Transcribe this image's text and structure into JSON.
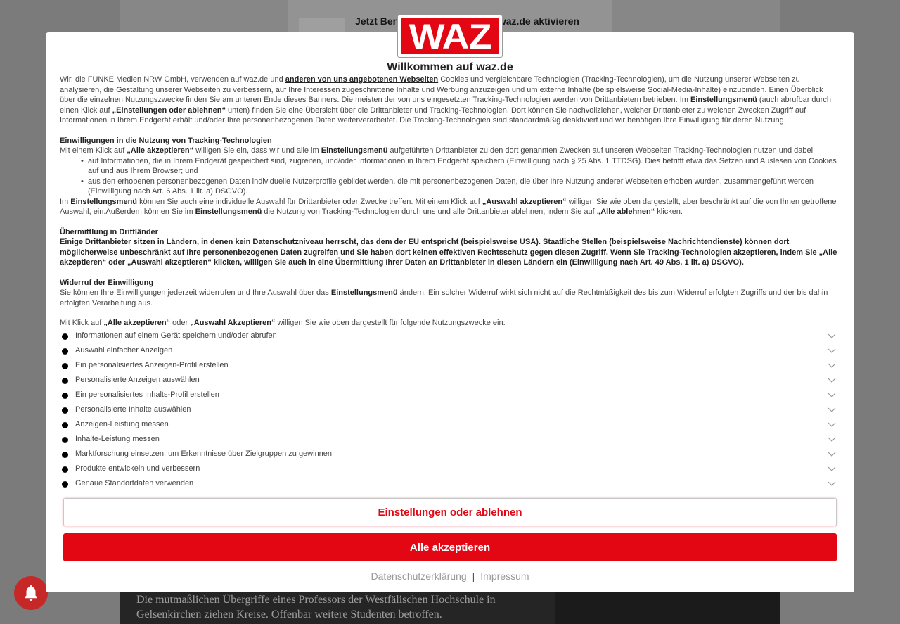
{
  "background": {
    "notify_text": "Jetzt Benachrichtigungen von waz.de aktivieren",
    "teaser_text": "Die mutmaßlichen Übergriffe eines Professors der Westfälischen Hochschule in Gelsenkirchen ziehen Kreise. Offenbar weitere Studenten betroffen."
  },
  "bell_icon": "bell-icon",
  "modal": {
    "logo_text": "WAZ",
    "title": "Willkommen auf waz.de",
    "intro": {
      "t1": "Wir, die FUNKE Medien NRW GmbH, verwenden auf waz.de und ",
      "link1": "anderen von uns angebotenen Webseiten",
      "t2": " Cookies und vergleichbare Technologien (Tracking-Technologien), um die Nutzung unserer Webseiten zu analysieren, die Gestaltung unserer Webseiten zu verbessern, auf Ihre Interessen zugeschnittene Inhalte und Werbung anzuzeigen und um externe Inhalte (beispielsweise Social-Media-Inhalte) einzubinden. Einen Überblick über die einzelnen Nutzungszwecke finden Sie am unteren Ende dieses Banners. Die meisten der von uns eingesetzten Tracking-Technologien werden von Drittanbietern betrieben. Im ",
      "b1": "Einstellungsmenü",
      "t3": " (auch abrufbar durch einen Klick auf ",
      "b2": "„Einstellungen oder ablehnen“",
      "t4": " unten) finden Sie eine Übersicht über die Drittanbieter und Tracking-Technologien. Dort können Sie nachvollziehen, welcher Drittanbieter zu welchen Zwecken Zugriff auf Informationen in Ihrem Endgerät erhält und/oder Ihre personenbezogenen Daten weiterverarbeitet. Die Tracking-Technologien sind standardmäßig deaktiviert und wir benötigen Ihre Einwilligung für deren Nutzung."
    },
    "consent": {
      "heading": "Einwilligungen in die Nutzung von Tracking-Technologien",
      "t1": "Mit einem Klick auf ",
      "b1": "„Alle akzeptieren“",
      "t2": " willigen Sie ein, dass wir und alle im ",
      "b2": "Einstellungsmenü",
      "t3": " aufgeführten Drittanbieter zu den dort genannten Zwecken auf unseren Webseiten Tracking-Technologien nutzen und dabei",
      "bullet1": "auf Informationen, die in Ihrem Endgerät gespeichert sind, zugreifen, und/oder Informationen in Ihrem Endgerät speichern (Einwilligung nach § 25 Abs. 1 TTDSG). Dies betrifft etwa das Setzen und Auslesen von Cookies auf und aus Ihrem Browser; und",
      "bullet2": "aus den erhobenen personenbezogenen Daten individuelle Nutzerprofile gebildet werden, die mit personenbezogenen Daten, die über Ihre Nutzung anderer Webseiten erhoben wurden, zusammengeführt werden (Einwilligung nach Art. 6 Abs. 1 lit. a) DSGVO).",
      "t4": "Im ",
      "b3": "Einstellungsmenü",
      "t5": " können Sie auch eine individuelle Auswahl für Drittanbieter oder Zwecke treffen. Mit einem Klick auf ",
      "b4": "„Auswahl akzeptieren“",
      "t6": " willigen Sie wie oben dargestellt, aber beschränkt auf die von Ihnen getroffene Auswahl, ein.Außerdem können Sie im ",
      "b5": "Einstellungsmenü",
      "t7": " die Nutzung von Tracking-Technologien durch uns und alle Drittanbieter ablehnen, indem Sie auf ",
      "b6": "„Alle ablehnen“",
      "t8": " klicken."
    },
    "transfer": {
      "heading": "Übermittlung in Drittländer",
      "text": "Einige Drittanbieter sitzen in Ländern, in denen kein Datenschutzniveau herrscht, das dem der EU entspricht (beispielsweise USA). Staatliche Stellen (beispielsweise Nachrichtendienste) können dort möglicherweise unbeschränkt auf Ihre personenbezogenen Daten zugreifen und Sie haben dort keinen effektiven Rechtsschutz gegen diesen Zugriff. Wenn Sie Tracking-Technologien akzeptieren, indem Sie „Alle akzeptieren“ oder „Auswahl akzeptieren“ klicken, willigen Sie auch in eine Übermittlung Ihrer Daten an Drittanbieter in diesen Ländern ein (Einwilligung nach Art. 49 Abs. 1 lit. a) DSGVO)."
    },
    "revoke": {
      "heading": "Widerruf der Einwilligung",
      "t1": "Sie können Ihre Einwilligungen jederzeit widerrufen und Ihre Auswahl über das ",
      "b1": "Einstellungsmenü",
      "t2": " ändern. Ein solcher Widerruf wirkt sich nicht auf die Rechtmäßigkeit des bis zum Widerruf erfolgten Zugriffs und der bis dahin erfolgten Verarbeitung aus."
    },
    "purposes_intro": {
      "t1": "Mit Klick auf ",
      "b1": "„Alle akzeptieren“",
      "t2": " oder ",
      "b2": "„Auswahl Akzeptieren“",
      "t3": " willigen Sie wie oben dargestellt für folgende Nutzungszwecke ein:"
    },
    "purposes": [
      "Informationen auf einem Gerät speichern und/oder abrufen",
      "Auswahl einfacher Anzeigen",
      "Ein personalisiertes Anzeigen-Profil erstellen",
      "Personalisierte Anzeigen auswählen",
      "Ein personalisiertes Inhalts-Profil erstellen",
      "Personalisierte Inhalte auswählen",
      "Anzeigen-Leistung messen",
      "Inhalte-Leistung messen",
      "Marktforschung einsetzen, um Erkenntnisse über Zielgruppen zu gewinnen",
      "Produkte entwickeln und verbessern",
      "Genaue Standortdaten verwenden"
    ],
    "btn_settings": "Einstellungen oder ablehnen",
    "btn_accept": "Alle akzeptieren",
    "footer_privacy": "Datenschutzerklärung",
    "footer_sep": "|",
    "footer_imprint": "Impressum",
    "colors": {
      "brand": "#e30613"
    }
  }
}
